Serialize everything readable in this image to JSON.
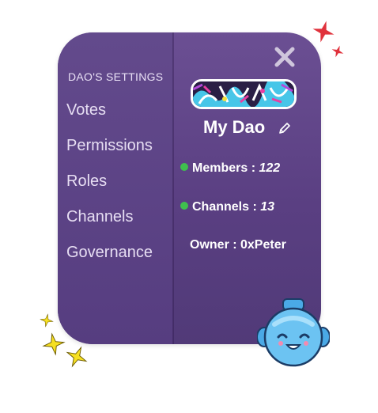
{
  "sidebar": {
    "title": "DAO'S SETTINGS",
    "items": [
      {
        "label": "Votes"
      },
      {
        "label": "Permissions"
      },
      {
        "label": "Roles"
      },
      {
        "label": "Channels"
      },
      {
        "label": "Governance"
      }
    ]
  },
  "dao": {
    "name": "My Dao",
    "members_label": "Members :",
    "members_value": "122",
    "channels_label": "Channels :",
    "channels_value": "13",
    "owner": "Owner : 0xPeter"
  },
  "icons": {
    "close": "close-icon",
    "edit": "pencil-icon",
    "status_dot": "online-dot",
    "mascot": "robot-mascot",
    "sparkles": "star-icon"
  },
  "colors": {
    "panel": "#5f4589",
    "status_online": "#3fbf4e",
    "star_red": "#e0323c",
    "star_yellow": "#f6e022",
    "robot_blue": "#5bb8ee"
  }
}
